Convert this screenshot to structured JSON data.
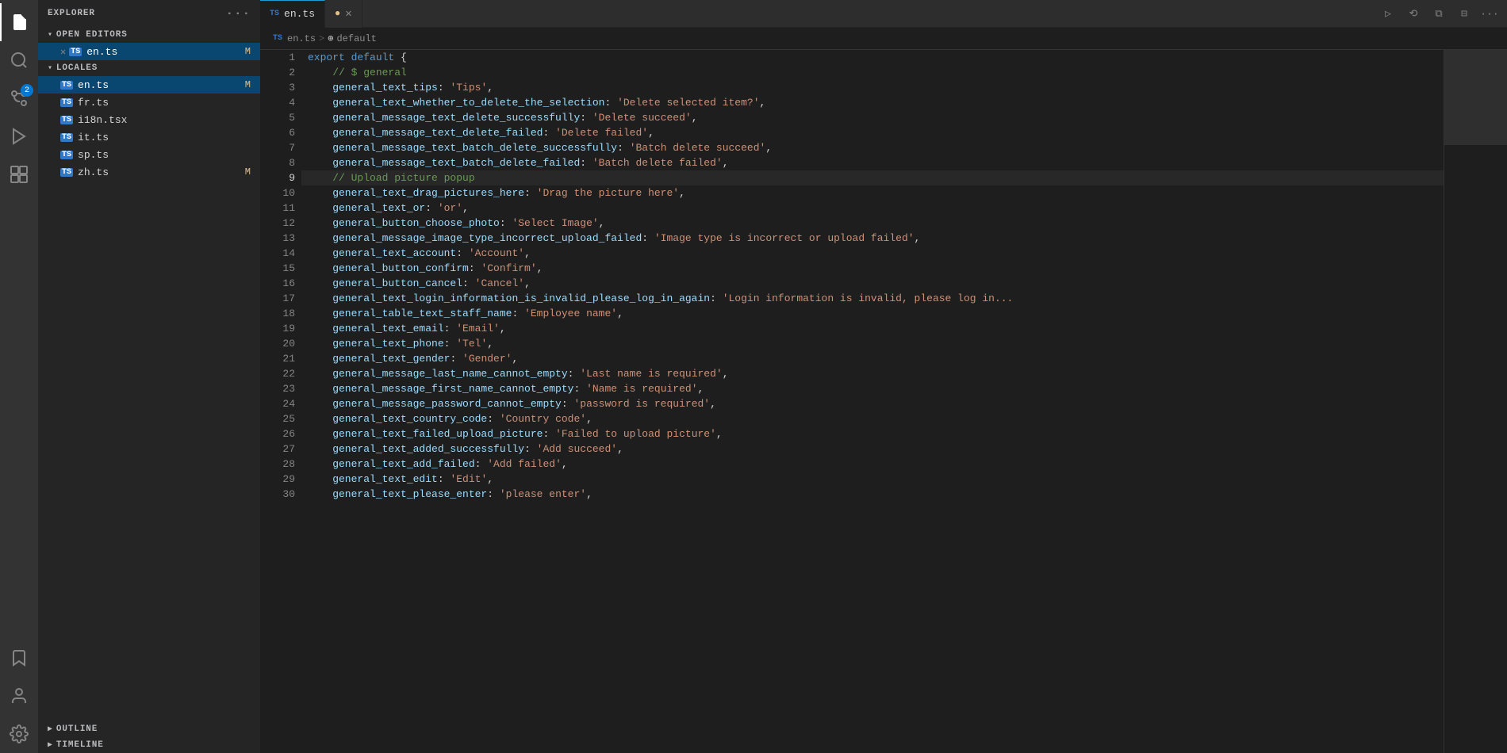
{
  "activityBar": {
    "icons": [
      {
        "name": "files-icon",
        "symbol": "🗂",
        "active": true
      },
      {
        "name": "search-icon",
        "symbol": "🔍",
        "active": false
      },
      {
        "name": "source-control-icon",
        "symbol": "⎇",
        "active": false,
        "badge": "2"
      },
      {
        "name": "run-icon",
        "symbol": "▷",
        "active": false
      },
      {
        "name": "extensions-icon",
        "symbol": "⊞",
        "active": false
      },
      {
        "name": "bookmarks-icon",
        "symbol": "🔖",
        "active": false
      },
      {
        "name": "account-icon",
        "symbol": "👤",
        "active": false
      },
      {
        "name": "settings-icon",
        "symbol": "⚙",
        "active": false
      }
    ]
  },
  "sidebar": {
    "explorerLabel": "EXPLORER",
    "openEditorsLabel": "OPEN EDITORS",
    "openFiles": [
      {
        "name": "en.ts",
        "modified": true,
        "active": true
      }
    ],
    "localesLabel": "LOCALES",
    "localeFiles": [
      {
        "name": "en.ts",
        "modified": true
      },
      {
        "name": "fr.ts",
        "modified": false
      },
      {
        "name": "i18n.tsx",
        "modified": false
      },
      {
        "name": "it.ts",
        "modified": false
      },
      {
        "name": "sp.ts",
        "modified": false
      },
      {
        "name": "zh.ts",
        "modified": true
      }
    ],
    "outlineLabel": "OUTLINE",
    "timelineLabel": "TIMELINE"
  },
  "tabs": [
    {
      "label": "en.ts",
      "type": "TS",
      "active": true,
      "modified": false,
      "closeable": false
    },
    {
      "label": "",
      "type": "",
      "active": false,
      "modified": true,
      "closeable": true
    }
  ],
  "breadcrumb": {
    "parts": [
      "TS en.ts",
      ">",
      "⊕ default"
    ]
  },
  "editor": {
    "lines": [
      {
        "num": 1,
        "content": [
          {
            "cls": "kw",
            "text": "export"
          },
          {
            "cls": "punct",
            "text": " "
          },
          {
            "cls": "kw",
            "text": "default"
          },
          {
            "cls": "punct",
            "text": " {"
          }
        ]
      },
      {
        "num": 2,
        "content": [
          {
            "cls": "comment",
            "text": "    // $ general"
          }
        ]
      },
      {
        "num": 3,
        "content": [
          {
            "cls": "prop",
            "text": "    general_text_tips"
          },
          {
            "cls": "punct",
            "text": ": "
          },
          {
            "cls": "str",
            "text": "'Tips'"
          },
          {
            "cls": "punct",
            "text": ","
          }
        ]
      },
      {
        "num": 4,
        "content": [
          {
            "cls": "prop",
            "text": "    general_text_whether_to_delete_the_selection"
          },
          {
            "cls": "punct",
            "text": ": "
          },
          {
            "cls": "str",
            "text": "'Delete selected item?'"
          },
          {
            "cls": "punct",
            "text": ","
          }
        ]
      },
      {
        "num": 5,
        "content": [
          {
            "cls": "prop",
            "text": "    general_message_text_delete_successfully"
          },
          {
            "cls": "punct",
            "text": ": "
          },
          {
            "cls": "str",
            "text": "'Delete succeed'"
          },
          {
            "cls": "punct",
            "text": ","
          }
        ]
      },
      {
        "num": 6,
        "content": [
          {
            "cls": "prop",
            "text": "    general_message_text_delete_failed"
          },
          {
            "cls": "punct",
            "text": ": "
          },
          {
            "cls": "str",
            "text": "'Delete failed'"
          },
          {
            "cls": "punct",
            "text": ","
          }
        ]
      },
      {
        "num": 7,
        "content": [
          {
            "cls": "prop",
            "text": "    general_message_text_batch_delete_successfully"
          },
          {
            "cls": "punct",
            "text": ": "
          },
          {
            "cls": "str",
            "text": "'Batch delete succeed'"
          },
          {
            "cls": "punct",
            "text": ","
          }
        ]
      },
      {
        "num": 8,
        "content": [
          {
            "cls": "prop",
            "text": "    general_message_text_batch_delete_failed"
          },
          {
            "cls": "punct",
            "text": ": "
          },
          {
            "cls": "str",
            "text": "'Batch delete failed'"
          },
          {
            "cls": "punct",
            "text": ","
          }
        ]
      },
      {
        "num": 9,
        "content": [
          {
            "cls": "comment",
            "text": "    // Upload picture popup"
          }
        ]
      },
      {
        "num": 10,
        "content": [
          {
            "cls": "prop",
            "text": "    general_text_drag_pictures_here"
          },
          {
            "cls": "punct",
            "text": ": "
          },
          {
            "cls": "str",
            "text": "'Drag the picture here'"
          },
          {
            "cls": "punct",
            "text": ","
          }
        ]
      },
      {
        "num": 11,
        "content": [
          {
            "cls": "prop",
            "text": "    general_text_or"
          },
          {
            "cls": "punct",
            "text": ": "
          },
          {
            "cls": "str",
            "text": "'or'"
          },
          {
            "cls": "punct",
            "text": ","
          }
        ]
      },
      {
        "num": 12,
        "content": [
          {
            "cls": "prop",
            "text": "    general_button_choose_photo"
          },
          {
            "cls": "punct",
            "text": ": "
          },
          {
            "cls": "str",
            "text": "'Select Image'"
          },
          {
            "cls": "punct",
            "text": ","
          }
        ]
      },
      {
        "num": 13,
        "content": [
          {
            "cls": "prop",
            "text": "    general_message_image_type_incorrect_upload_failed"
          },
          {
            "cls": "punct",
            "text": ": "
          },
          {
            "cls": "str",
            "text": "'Image type is incorrect or upload failed'"
          },
          {
            "cls": "punct",
            "text": ","
          }
        ]
      },
      {
        "num": 14,
        "content": [
          {
            "cls": "prop",
            "text": "    general_text_account"
          },
          {
            "cls": "punct",
            "text": ": "
          },
          {
            "cls": "str",
            "text": "'Account'"
          },
          {
            "cls": "punct",
            "text": ","
          }
        ]
      },
      {
        "num": 15,
        "content": [
          {
            "cls": "prop",
            "text": "    general_button_confirm"
          },
          {
            "cls": "punct",
            "text": ": "
          },
          {
            "cls": "str",
            "text": "'Confirm'"
          },
          {
            "cls": "punct",
            "text": ","
          }
        ]
      },
      {
        "num": 16,
        "content": [
          {
            "cls": "prop",
            "text": "    general_button_cancel"
          },
          {
            "cls": "punct",
            "text": ": "
          },
          {
            "cls": "str",
            "text": "'Cancel'"
          },
          {
            "cls": "punct",
            "text": ","
          }
        ]
      },
      {
        "num": 17,
        "content": [
          {
            "cls": "prop",
            "text": "    general_text_login_information_is_invalid_please_log_in_again"
          },
          {
            "cls": "punct",
            "text": ": "
          },
          {
            "cls": "str",
            "text": "'Login information is invalid, please log in..."
          }
        ]
      },
      {
        "num": 18,
        "content": [
          {
            "cls": "prop",
            "text": "    general_table_text_staff_name"
          },
          {
            "cls": "punct",
            "text": ": "
          },
          {
            "cls": "str",
            "text": "'Employee name'"
          },
          {
            "cls": "punct",
            "text": ","
          }
        ]
      },
      {
        "num": 19,
        "content": [
          {
            "cls": "prop",
            "text": "    general_text_email"
          },
          {
            "cls": "punct",
            "text": ": "
          },
          {
            "cls": "str",
            "text": "'Email'"
          },
          {
            "cls": "punct",
            "text": ","
          }
        ]
      },
      {
        "num": 20,
        "content": [
          {
            "cls": "prop",
            "text": "    general_text_phone"
          },
          {
            "cls": "punct",
            "text": ": "
          },
          {
            "cls": "str",
            "text": "'Tel'"
          },
          {
            "cls": "punct",
            "text": ","
          }
        ]
      },
      {
        "num": 21,
        "content": [
          {
            "cls": "prop",
            "text": "    general_text_gender"
          },
          {
            "cls": "punct",
            "text": ": "
          },
          {
            "cls": "str",
            "text": "'Gender'"
          },
          {
            "cls": "punct",
            "text": ","
          }
        ]
      },
      {
        "num": 22,
        "content": [
          {
            "cls": "prop",
            "text": "    general_message_last_name_cannot_empty"
          },
          {
            "cls": "punct",
            "text": ": "
          },
          {
            "cls": "str",
            "text": "'Last name is required'"
          },
          {
            "cls": "punct",
            "text": ","
          }
        ]
      },
      {
        "num": 23,
        "content": [
          {
            "cls": "prop",
            "text": "    general_message_first_name_cannot_empty"
          },
          {
            "cls": "punct",
            "text": ": "
          },
          {
            "cls": "str",
            "text": "'Name is required'"
          },
          {
            "cls": "punct",
            "text": ","
          }
        ]
      },
      {
        "num": 24,
        "content": [
          {
            "cls": "prop",
            "text": "    general_message_password_cannot_empty"
          },
          {
            "cls": "punct",
            "text": ": "
          },
          {
            "cls": "str",
            "text": "'password is required'"
          },
          {
            "cls": "punct",
            "text": ","
          }
        ]
      },
      {
        "num": 25,
        "content": [
          {
            "cls": "prop",
            "text": "    general_text_country_code"
          },
          {
            "cls": "punct",
            "text": ": "
          },
          {
            "cls": "str",
            "text": "'Country code'"
          },
          {
            "cls": "punct",
            "text": ","
          }
        ]
      },
      {
        "num": 26,
        "content": [
          {
            "cls": "prop",
            "text": "    general_text_failed_upload_picture"
          },
          {
            "cls": "punct",
            "text": ": "
          },
          {
            "cls": "str",
            "text": "'Failed to upload picture'"
          },
          {
            "cls": "punct",
            "text": ","
          }
        ]
      },
      {
        "num": 27,
        "content": [
          {
            "cls": "prop",
            "text": "    general_text_added_successfully"
          },
          {
            "cls": "punct",
            "text": ": "
          },
          {
            "cls": "str",
            "text": "'Add succeed'"
          },
          {
            "cls": "punct",
            "text": ","
          }
        ]
      },
      {
        "num": 28,
        "content": [
          {
            "cls": "prop",
            "text": "    general_text_add_failed"
          },
          {
            "cls": "punct",
            "text": ": "
          },
          {
            "cls": "str",
            "text": "'Add failed'"
          },
          {
            "cls": "punct",
            "text": ","
          }
        ]
      },
      {
        "num": 29,
        "content": [
          {
            "cls": "prop",
            "text": "    general_text_edit"
          },
          {
            "cls": "punct",
            "text": ": "
          },
          {
            "cls": "str",
            "text": "'Edit'"
          },
          {
            "cls": "punct",
            "text": ","
          }
        ]
      },
      {
        "num": 30,
        "content": [
          {
            "cls": "prop",
            "text": "    general_text_please_enter"
          },
          {
            "cls": "punct",
            "text": ": "
          },
          {
            "cls": "str",
            "text": "'please enter'"
          },
          {
            "cls": "punct",
            "text": ","
          }
        ]
      }
    ]
  }
}
